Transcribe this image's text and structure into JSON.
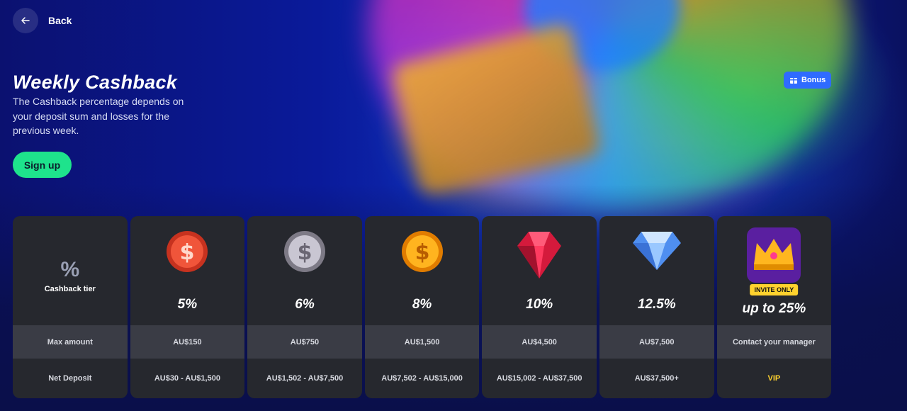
{
  "nav": {
    "back_label": "Back"
  },
  "promo": {
    "title": "Weekly Cashback",
    "description": "The Cashback percentage depends on your deposit sum and losses for the previous week.",
    "signup_label": "Sign up",
    "badge_label": "Bonus"
  },
  "table": {
    "header_label": "Cashback tier",
    "row_max_label": "Max amount",
    "row_deposit_label": "Net Deposit",
    "tiers": [
      {
        "icon": "red-coin-icon",
        "percent": "5%",
        "max": "AU$150",
        "deposit": "AU$30 - AU$1,500"
      },
      {
        "icon": "silver-coin-icon",
        "percent": "6%",
        "max": "AU$750",
        "deposit": "AU$1,502 - AU$7,500"
      },
      {
        "icon": "gold-coin-icon",
        "percent": "8%",
        "max": "AU$1,500",
        "deposit": "AU$7,502 - AU$15,000"
      },
      {
        "icon": "ruby-gem-icon",
        "percent": "10%",
        "max": "AU$4,500",
        "deposit": "AU$15,002 - AU$37,500"
      },
      {
        "icon": "diamond-icon",
        "percent": "12.5%",
        "max": "AU$7,500",
        "deposit": "AU$37,500+"
      },
      {
        "icon": "crown-icon",
        "badge": "INVITE ONLY",
        "percent": "up to 25%",
        "max": "Contact your manager",
        "deposit": "VIP"
      }
    ]
  },
  "colors": {
    "accent_green": "#1ee38c",
    "vip_yellow": "#ffd22e",
    "badge_blue": "#2f6bff"
  }
}
